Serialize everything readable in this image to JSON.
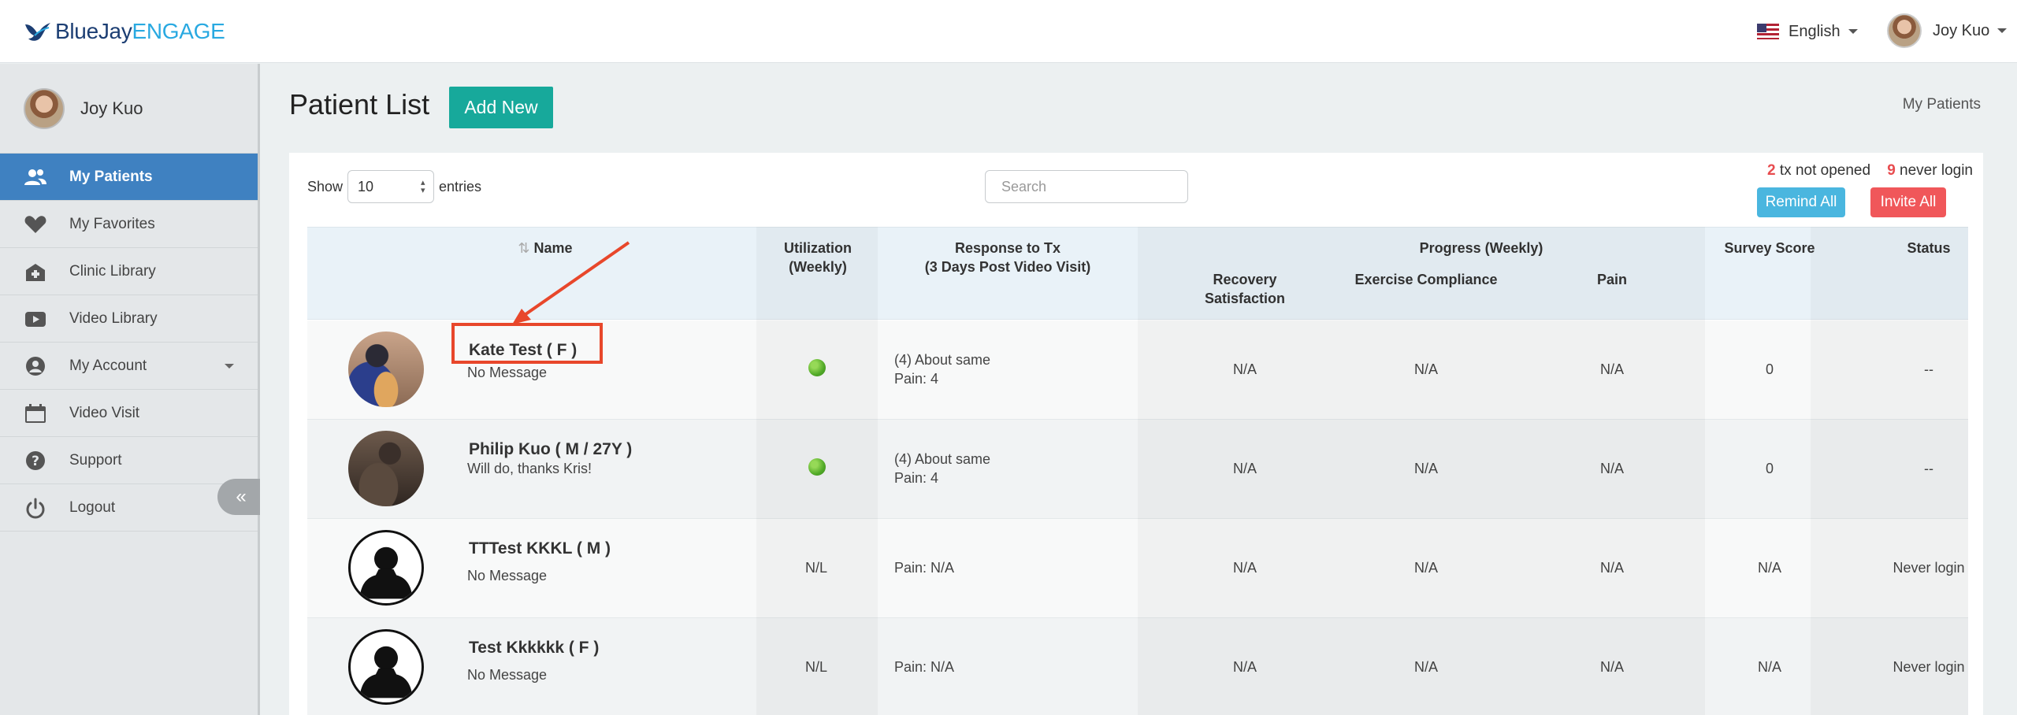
{
  "brand": {
    "part1": "BlueJay",
    "part2": "ENGAGE"
  },
  "header": {
    "language": "English",
    "user_name": "Joy Kuo"
  },
  "sidebar": {
    "user_name": "Joy Kuo",
    "items": [
      {
        "label": "My Patients",
        "icon": "users-icon",
        "active": true
      },
      {
        "label": "My Favorites",
        "icon": "heart-icon"
      },
      {
        "label": "Clinic Library",
        "icon": "clinic-icon"
      },
      {
        "label": "Video Library",
        "icon": "play-icon"
      },
      {
        "label": "My Account",
        "icon": "account-icon",
        "has_dropdown": true
      },
      {
        "label": "Video Visit",
        "icon": "calendar-icon"
      },
      {
        "label": "Support",
        "icon": "help-icon"
      },
      {
        "label": "Logout",
        "icon": "power-icon"
      }
    ],
    "collapse_label": "«"
  },
  "page": {
    "title": "Patient List",
    "add_label": "Add New",
    "breadcrumb": "My Patients"
  },
  "controls": {
    "show_label": "Show",
    "entries_value": "10",
    "entries_label": "entries",
    "search_placeholder": "Search",
    "stats_tx_count": "2",
    "stats_tx_label": "tx not opened",
    "stats_login_count": "9",
    "stats_login_label": "never login",
    "remind_label": "Remind All",
    "invite_label": "Invite All"
  },
  "table": {
    "headers": {
      "sort_icon": "⇅",
      "name": "Name",
      "utilization_1": "Utilization",
      "utilization_2": "(Weekly)",
      "response_1": "Response to Tx",
      "response_2": "(3 Days Post Video Visit)",
      "progress": "Progress (Weekly)",
      "recovery_1": "Recovery",
      "recovery_2": "Satisfaction",
      "exercise": "Exercise Compliance",
      "pain": "Pain",
      "survey": "Survey Score",
      "status": "Status"
    },
    "rows": [
      {
        "name": "Kate Test ( F )",
        "message": "No Message",
        "utilization": "green",
        "response_1": "(4) About same",
        "response_2": "Pain: 4",
        "recovery": "N/A",
        "exercise": "N/A",
        "pain": "N/A",
        "survey": "0",
        "status": "--",
        "avatar": "photo"
      },
      {
        "name": "Philip Kuo ( M / 27Y )",
        "message": "Will do, thanks Kris!",
        "utilization": "green",
        "response_1": "(4) About same",
        "response_2": "Pain: 4",
        "recovery": "N/A",
        "exercise": "N/A",
        "pain": "N/A",
        "survey": "0",
        "status": "--",
        "avatar": "photo"
      },
      {
        "name": "TTTest KKKL ( M )",
        "message": "No Message",
        "utilization": "N/L",
        "response_1": "Pain: N/A",
        "response_2": "",
        "recovery": "N/A",
        "exercise": "N/A",
        "pain": "N/A",
        "survey": "N/A",
        "status": "Never login",
        "avatar": "silhouette"
      },
      {
        "name": "Test Kkkkkk ( F )",
        "message": "No Message",
        "utilization": "N/L",
        "response_1": "Pain: N/A",
        "response_2": "",
        "recovery": "N/A",
        "exercise": "N/A",
        "pain": "N/A",
        "survey": "N/A",
        "status": "Never login",
        "avatar": "silhouette"
      }
    ]
  },
  "colors": {
    "accent_blue": "#3f81c1",
    "add_green": "#17a99b",
    "remind_blue": "#4ab6df",
    "invite_red": "#f0575a",
    "annotation_red": "#e8472b"
  }
}
